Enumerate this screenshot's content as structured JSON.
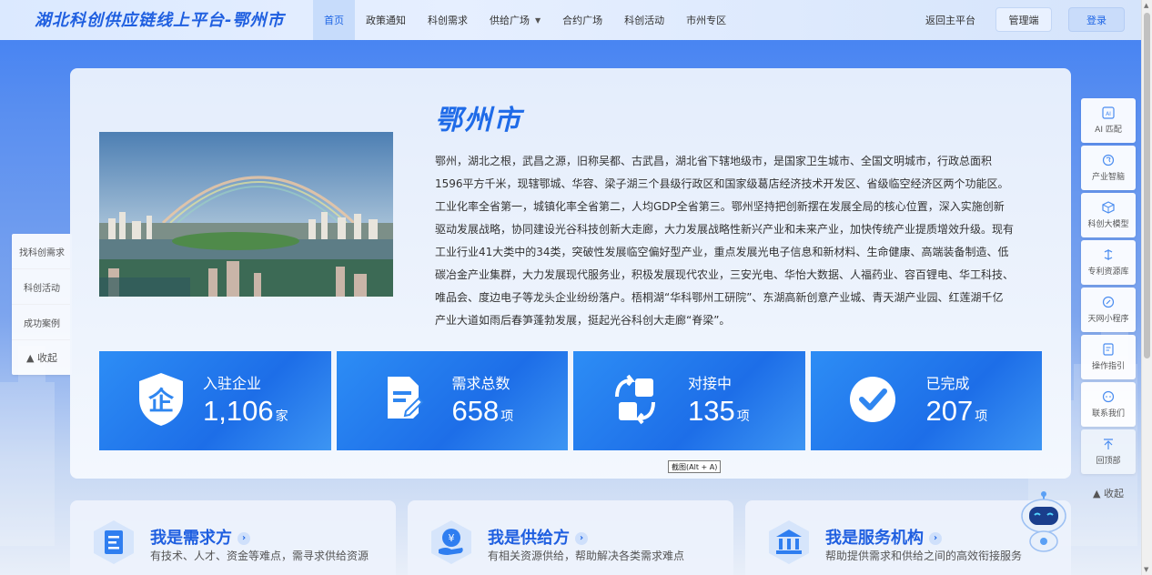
{
  "header": {
    "logo": "湖北科创供应链线上平台-鄂州市",
    "nav": [
      {
        "label": "首页",
        "active": true
      },
      {
        "label": "政策通知"
      },
      {
        "label": "科创需求"
      },
      {
        "label": "供给广场",
        "dropdown": true
      },
      {
        "label": "合约广场"
      },
      {
        "label": "科创活动"
      },
      {
        "label": "市州专区"
      }
    ],
    "return_link": "返回主平台",
    "admin_button": "管理端",
    "login_button": "登录"
  },
  "left_panel": {
    "items": [
      "找科创需求",
      "科创活动",
      "成功案例"
    ],
    "collapse": "▲ 收起"
  },
  "right_panel": {
    "items": [
      {
        "label": "AI 匹配",
        "icon": "ai-match-icon"
      },
      {
        "label": "产业智脑",
        "icon": "industry-brain-icon"
      },
      {
        "label": "科创大模型",
        "icon": "model-icon"
      },
      {
        "label": "专利资源库",
        "icon": "patent-icon"
      },
      {
        "label": "天网小程序",
        "icon": "miniapp-icon"
      },
      {
        "label": "操作指引",
        "icon": "guide-icon"
      },
      {
        "label": "联系我们",
        "icon": "contact-icon"
      },
      {
        "label": "回顶部",
        "icon": "back-to-top-icon"
      }
    ],
    "collapse": "▲ 收起"
  },
  "city": {
    "title": "鄂州市",
    "description": "鄂州，湖北之根，武昌之源，旧称吴都、古武昌，湖北省下辖地级市，是国家卫生城市、全国文明城市，行政总面积1596平方千米，现辖鄂城、华容、梁子湖三个县级行政区和国家级葛店经济技术开发区、省级临空经济区两个功能区。工业化率全省第一，城镇化率全省第二，人均GDP全省第三。鄂州坚持把创新摆在发展全局的核心位置，深入实施创新驱动发展战略，协同建设光谷科技创新大走廊，大力发展战略性新兴产业和未来产业，加快传统产业提质增效升级。现有工业行业41大类中的34类，突破性发展临空偏好型产业，重点发展光电子信息和新材料、生命健康、高端装备制造、低碳冶金产业集群，大力发展现代服务业，积极发展现代农业，三安光电、华怡大数据、人福药业、容百锂电、华工科技、唯品会、度边电子等龙头企业纷纷落户。梧桐湖“华科鄂州工研院”、东湖高新创意产业城、青天湖产业园、红莲湖千亿产业大道如雨后春笋蓬勃发展，挺起光谷科创大走廊“脊梁”。"
  },
  "stats": [
    {
      "label": "入驻企业",
      "value": "1,106",
      "unit": "家",
      "icon": "enterprise-shield-icon"
    },
    {
      "label": "需求总数",
      "value": "658",
      "unit": "项",
      "icon": "document-edit-icon"
    },
    {
      "label": "对接中",
      "value": "135",
      "unit": "项",
      "icon": "exchange-icon"
    },
    {
      "label": "已完成",
      "value": "207",
      "unit": "项",
      "icon": "check-circle-icon"
    }
  ],
  "tooltip": "截图(Alt + A)",
  "roles": [
    {
      "title": "我是需求方",
      "desc": "有技术、人才、资金等难点，需寻求供给资源",
      "icon": "demand-icon"
    },
    {
      "title": "我是供给方",
      "desc": "有相关资源供给，帮助解决各类需求难点",
      "icon": "supply-icon"
    },
    {
      "title": "我是服务机构",
      "desc": "帮助提供需求和供给之间的高效衔接服务",
      "icon": "institution-icon"
    }
  ],
  "colors": {
    "brand": "#1f66e5",
    "stat_blue": "#1d6ee8"
  }
}
